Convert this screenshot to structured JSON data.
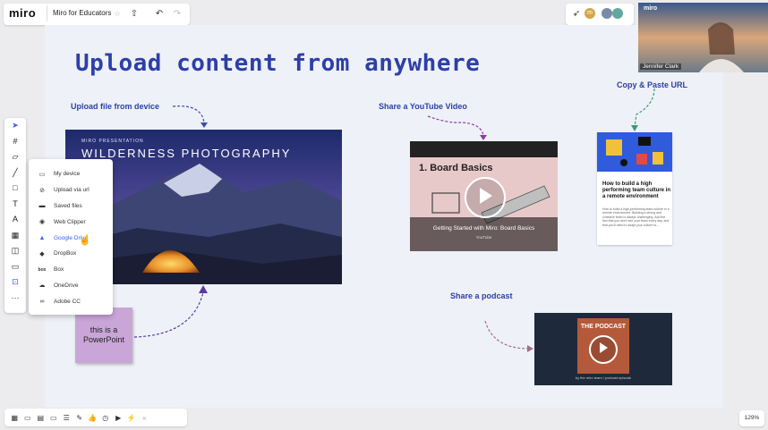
{
  "app": {
    "logo": "miro",
    "board_title": "Miro for Educators"
  },
  "topbar": {
    "star_icon": "star-icon",
    "share_icon": "upload-icon",
    "undo_icon": "undo-icon",
    "redo_icon": "redo-icon",
    "avatar_initial": "m"
  },
  "video_call": {
    "name": "Jennifer Clark",
    "logo": "miro"
  },
  "board": {
    "title": "Upload content from anywhere",
    "labels": {
      "upload_device": "Upload file from device",
      "youtube": "Share a YouTube Video",
      "copy_url": "Copy & Paste URL",
      "podcast": "Share a podcast"
    },
    "photo": {
      "kicker": "MIRO PRESENTATION",
      "title": "WILDERNESS PHOTOGRAPHY"
    },
    "youtube_card": {
      "slide_title": "1. Board Basics",
      "caption": "Getting Started with Miro: Board Basics",
      "source": "YouTube"
    },
    "article": {
      "title": "How to build a high performing team culture in a remote environment",
      "body": "How to build a high-performing team culture in a remote environment. Building a strong and cohesive team is always challenging. Add the fact that you don't see your team every day, and that you'll need to adapt your culture to..."
    },
    "podcast_card": {
      "title": "THE PODCAST",
      "caption": "by the miro team / podcast episode"
    },
    "sticky": "this is a PowerPoint"
  },
  "toolbar": {
    "tools": [
      "cursor-icon",
      "frame-icon",
      "sticky-note-icon",
      "pen-icon",
      "shape-icon",
      "text-icon",
      "connector-icon",
      "template-icon",
      "card-icon",
      "comment-icon",
      "upload-icon",
      "more-icon"
    ]
  },
  "upload_menu": {
    "items": [
      {
        "label": "My device",
        "icon": "laptop-icon"
      },
      {
        "label": "Upload via url",
        "icon": "link-icon"
      },
      {
        "label": "Saved files",
        "icon": "folder-icon"
      },
      {
        "label": "Web Clipper",
        "icon": "chrome-icon"
      },
      {
        "label": "Google Drive",
        "icon": "google-drive-icon"
      },
      {
        "label": "DropBox",
        "icon": "dropbox-icon"
      },
      {
        "label": "Box",
        "icon": "box-icon"
      },
      {
        "label": "OneDrive",
        "icon": "onedrive-icon"
      },
      {
        "label": "Adobe CC",
        "icon": "adobe-icon"
      }
    ]
  },
  "bottombar": {
    "icons": [
      "frames-icon",
      "comments-icon",
      "chat-icon",
      "present-icon",
      "notes-icon",
      "edit-icon",
      "reactions-icon",
      "timer-icon",
      "video-icon",
      "apps-icon",
      "collapse-icon"
    ]
  },
  "zoom": "129%",
  "colors": {
    "title_blue": "#2d3fa8",
    "sticky_purple": "#c9a5d8",
    "accent_blue": "#3c5bf4"
  }
}
